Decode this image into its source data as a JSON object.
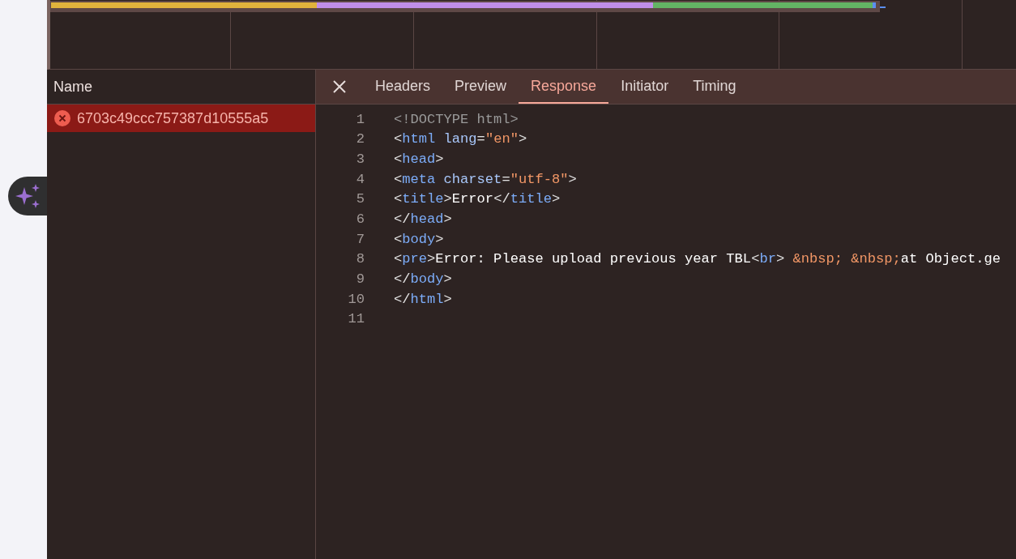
{
  "request_list": {
    "header": "Name",
    "rows": [
      {
        "name": "6703c49ccc757387d10555a5",
        "error": true,
        "selected": true
      }
    ]
  },
  "details": {
    "tabs": [
      {
        "label": "Headers",
        "selected": false
      },
      {
        "label": "Preview",
        "selected": false
      },
      {
        "label": "Response",
        "selected": true
      },
      {
        "label": "Initiator",
        "selected": false
      },
      {
        "label": "Timing",
        "selected": false
      }
    ],
    "lines": [
      {
        "number": "1",
        "tokens": [
          {
            "kind": "doctype",
            "text": "<!DOCTYPE html>"
          }
        ]
      },
      {
        "number": "2",
        "tokens": [
          {
            "kind": "punct",
            "text": "<"
          },
          {
            "kind": "tag",
            "text": "html "
          },
          {
            "kind": "attr",
            "text": "lang"
          },
          {
            "kind": "punct",
            "text": "="
          },
          {
            "kind": "string",
            "text": "\"en\""
          },
          {
            "kind": "punct",
            "text": ">"
          }
        ]
      },
      {
        "number": "3",
        "tokens": [
          {
            "kind": "punct",
            "text": "<"
          },
          {
            "kind": "tag",
            "text": "head"
          },
          {
            "kind": "punct",
            "text": ">"
          }
        ]
      },
      {
        "number": "4",
        "tokens": [
          {
            "kind": "punct",
            "text": "<"
          },
          {
            "kind": "tag",
            "text": "meta "
          },
          {
            "kind": "attr",
            "text": "charset"
          },
          {
            "kind": "punct",
            "text": "="
          },
          {
            "kind": "string",
            "text": "\"utf-8\""
          },
          {
            "kind": "punct",
            "text": ">"
          }
        ]
      },
      {
        "number": "5",
        "tokens": [
          {
            "kind": "punct",
            "text": "<"
          },
          {
            "kind": "tag",
            "text": "title"
          },
          {
            "kind": "punct",
            "text": ">"
          },
          {
            "kind": "text",
            "text": "Error"
          },
          {
            "kind": "punct",
            "text": "</"
          },
          {
            "kind": "tag",
            "text": "title"
          },
          {
            "kind": "punct",
            "text": ">"
          }
        ]
      },
      {
        "number": "6",
        "tokens": [
          {
            "kind": "punct",
            "text": "</"
          },
          {
            "kind": "tag",
            "text": "head"
          },
          {
            "kind": "punct",
            "text": ">"
          }
        ]
      },
      {
        "number": "7",
        "tokens": [
          {
            "kind": "punct",
            "text": "<"
          },
          {
            "kind": "tag",
            "text": "body"
          },
          {
            "kind": "punct",
            "text": ">"
          }
        ]
      },
      {
        "number": "8",
        "tokens": [
          {
            "kind": "punct",
            "text": "<"
          },
          {
            "kind": "tag",
            "text": "pre"
          },
          {
            "kind": "punct",
            "text": ">"
          },
          {
            "kind": "text",
            "text": "Error: Please upload previous year TBL"
          },
          {
            "kind": "punct",
            "text": "<"
          },
          {
            "kind": "tag",
            "text": "br"
          },
          {
            "kind": "punct",
            "text": "> "
          },
          {
            "kind": "entity",
            "text": "&nbsp; "
          },
          {
            "kind": "entity",
            "text": "&nbsp;"
          },
          {
            "kind": "text",
            "text": "at Object.ge"
          }
        ]
      },
      {
        "number": "9",
        "tokens": [
          {
            "kind": "punct",
            "text": "</"
          },
          {
            "kind": "tag",
            "text": "body"
          },
          {
            "kind": "punct",
            "text": ">"
          }
        ]
      },
      {
        "number": "10",
        "tokens": [
          {
            "kind": "punct",
            "text": "</"
          },
          {
            "kind": "tag",
            "text": "html"
          },
          {
            "kind": "punct",
            "text": ">"
          }
        ]
      },
      {
        "number": "11"
      }
    ]
  }
}
